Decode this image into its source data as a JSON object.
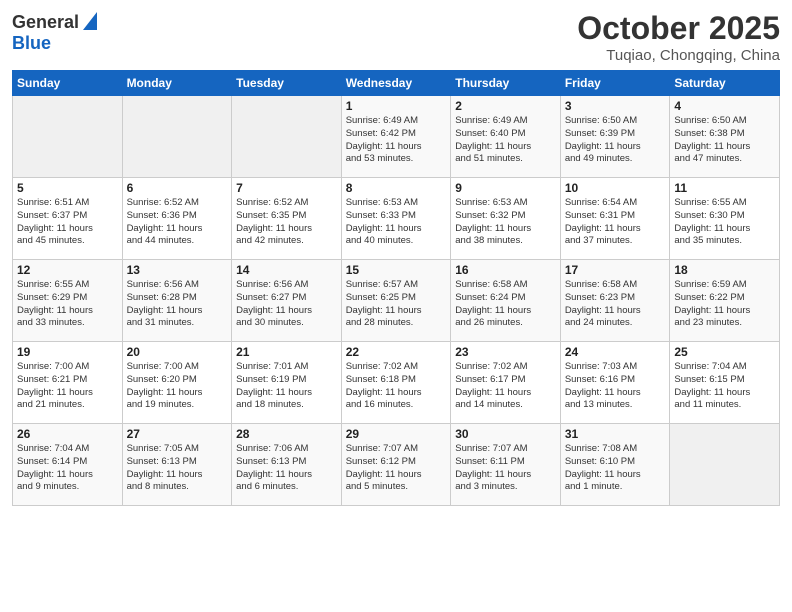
{
  "header": {
    "logo_line1": "General",
    "logo_line2": "Blue",
    "month": "October 2025",
    "location": "Tuqiao, Chongqing, China"
  },
  "weekdays": [
    "Sunday",
    "Monday",
    "Tuesday",
    "Wednesday",
    "Thursday",
    "Friday",
    "Saturday"
  ],
  "weeks": [
    [
      {
        "day": "",
        "info": ""
      },
      {
        "day": "",
        "info": ""
      },
      {
        "day": "",
        "info": ""
      },
      {
        "day": "1",
        "info": "Sunrise: 6:49 AM\nSunset: 6:42 PM\nDaylight: 11 hours\nand 53 minutes."
      },
      {
        "day": "2",
        "info": "Sunrise: 6:49 AM\nSunset: 6:40 PM\nDaylight: 11 hours\nand 51 minutes."
      },
      {
        "day": "3",
        "info": "Sunrise: 6:50 AM\nSunset: 6:39 PM\nDaylight: 11 hours\nand 49 minutes."
      },
      {
        "day": "4",
        "info": "Sunrise: 6:50 AM\nSunset: 6:38 PM\nDaylight: 11 hours\nand 47 minutes."
      }
    ],
    [
      {
        "day": "5",
        "info": "Sunrise: 6:51 AM\nSunset: 6:37 PM\nDaylight: 11 hours\nand 45 minutes."
      },
      {
        "day": "6",
        "info": "Sunrise: 6:52 AM\nSunset: 6:36 PM\nDaylight: 11 hours\nand 44 minutes."
      },
      {
        "day": "7",
        "info": "Sunrise: 6:52 AM\nSunset: 6:35 PM\nDaylight: 11 hours\nand 42 minutes."
      },
      {
        "day": "8",
        "info": "Sunrise: 6:53 AM\nSunset: 6:33 PM\nDaylight: 11 hours\nand 40 minutes."
      },
      {
        "day": "9",
        "info": "Sunrise: 6:53 AM\nSunset: 6:32 PM\nDaylight: 11 hours\nand 38 minutes."
      },
      {
        "day": "10",
        "info": "Sunrise: 6:54 AM\nSunset: 6:31 PM\nDaylight: 11 hours\nand 37 minutes."
      },
      {
        "day": "11",
        "info": "Sunrise: 6:55 AM\nSunset: 6:30 PM\nDaylight: 11 hours\nand 35 minutes."
      }
    ],
    [
      {
        "day": "12",
        "info": "Sunrise: 6:55 AM\nSunset: 6:29 PM\nDaylight: 11 hours\nand 33 minutes."
      },
      {
        "day": "13",
        "info": "Sunrise: 6:56 AM\nSunset: 6:28 PM\nDaylight: 11 hours\nand 31 minutes."
      },
      {
        "day": "14",
        "info": "Sunrise: 6:56 AM\nSunset: 6:27 PM\nDaylight: 11 hours\nand 30 minutes."
      },
      {
        "day": "15",
        "info": "Sunrise: 6:57 AM\nSunset: 6:25 PM\nDaylight: 11 hours\nand 28 minutes."
      },
      {
        "day": "16",
        "info": "Sunrise: 6:58 AM\nSunset: 6:24 PM\nDaylight: 11 hours\nand 26 minutes."
      },
      {
        "day": "17",
        "info": "Sunrise: 6:58 AM\nSunset: 6:23 PM\nDaylight: 11 hours\nand 24 minutes."
      },
      {
        "day": "18",
        "info": "Sunrise: 6:59 AM\nSunset: 6:22 PM\nDaylight: 11 hours\nand 23 minutes."
      }
    ],
    [
      {
        "day": "19",
        "info": "Sunrise: 7:00 AM\nSunset: 6:21 PM\nDaylight: 11 hours\nand 21 minutes."
      },
      {
        "day": "20",
        "info": "Sunrise: 7:00 AM\nSunset: 6:20 PM\nDaylight: 11 hours\nand 19 minutes."
      },
      {
        "day": "21",
        "info": "Sunrise: 7:01 AM\nSunset: 6:19 PM\nDaylight: 11 hours\nand 18 minutes."
      },
      {
        "day": "22",
        "info": "Sunrise: 7:02 AM\nSunset: 6:18 PM\nDaylight: 11 hours\nand 16 minutes."
      },
      {
        "day": "23",
        "info": "Sunrise: 7:02 AM\nSunset: 6:17 PM\nDaylight: 11 hours\nand 14 minutes."
      },
      {
        "day": "24",
        "info": "Sunrise: 7:03 AM\nSunset: 6:16 PM\nDaylight: 11 hours\nand 13 minutes."
      },
      {
        "day": "25",
        "info": "Sunrise: 7:04 AM\nSunset: 6:15 PM\nDaylight: 11 hours\nand 11 minutes."
      }
    ],
    [
      {
        "day": "26",
        "info": "Sunrise: 7:04 AM\nSunset: 6:14 PM\nDaylight: 11 hours\nand 9 minutes."
      },
      {
        "day": "27",
        "info": "Sunrise: 7:05 AM\nSunset: 6:13 PM\nDaylight: 11 hours\nand 8 minutes."
      },
      {
        "day": "28",
        "info": "Sunrise: 7:06 AM\nSunset: 6:13 PM\nDaylight: 11 hours\nand 6 minutes."
      },
      {
        "day": "29",
        "info": "Sunrise: 7:07 AM\nSunset: 6:12 PM\nDaylight: 11 hours\nand 5 minutes."
      },
      {
        "day": "30",
        "info": "Sunrise: 7:07 AM\nSunset: 6:11 PM\nDaylight: 11 hours\nand 3 minutes."
      },
      {
        "day": "31",
        "info": "Sunrise: 7:08 AM\nSunset: 6:10 PM\nDaylight: 11 hours\nand 1 minute."
      },
      {
        "day": "",
        "info": ""
      }
    ]
  ]
}
